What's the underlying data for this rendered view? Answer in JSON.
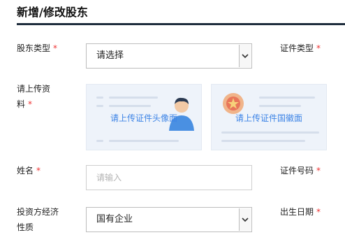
{
  "header": {
    "title": "新增/修改股东"
  },
  "form": {
    "shareholder_type": {
      "label": "股东类型",
      "required": "*",
      "value": "请选择"
    },
    "id_type": {
      "label": "证件类型",
      "required": "*"
    },
    "upload": {
      "label_line1": "请上传资",
      "label_line2": "料",
      "required": "*",
      "portrait_caption": "请上传证件头像面",
      "emblem_caption": "请上传证件国徽面"
    },
    "name": {
      "label": "姓名",
      "required": "*",
      "placeholder": "请输入"
    },
    "id_number": {
      "label": "证件号码",
      "required": "*"
    },
    "investor_economy": {
      "label_line1": "投资方经济",
      "label_line2": "性质",
      "value": "国有企业"
    },
    "birth_date": {
      "label": "出生日期",
      "required": "*"
    }
  },
  "colors": {
    "accent": "#3d84e6",
    "required": "#e33333",
    "title_rule": "#1f2d3d"
  }
}
